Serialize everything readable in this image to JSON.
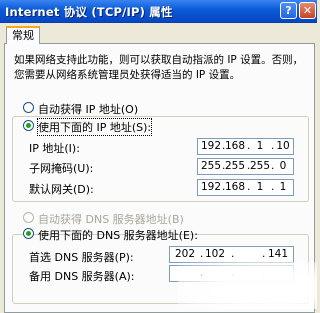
{
  "window": {
    "title": "Internet 协议 (TCP/IP) 属性",
    "help_glyph": "?",
    "close_glyph": "✕"
  },
  "tabs": [
    {
      "label": "常规",
      "active": true
    }
  ],
  "description": "如果网络支持此功能，则可以获取自动指派的 IP 设置。否则，您需要从网络系统管理员处获得适当的 IP 设置。",
  "ip_section": {
    "auto_option": "自动获得 IP 地址(O)",
    "manual_option": "使用下面的 IP 地址(S):",
    "selected": "manual",
    "fields": [
      {
        "label": "IP 地址(I):",
        "octets": [
          "192",
          "168",
          "1",
          "10"
        ]
      },
      {
        "label": "子网掩码(U):",
        "octets": [
          "255",
          "255",
          "255",
          "0"
        ]
      },
      {
        "label": "默认网关(D):",
        "octets": [
          "192",
          "168",
          "1",
          "1"
        ]
      }
    ]
  },
  "dns_section": {
    "auto_option": "自动获得 DNS 服务器地址(B)",
    "manual_option": "使用下面的 DNS 服务器地址(E):",
    "selected": "manual",
    "fields": [
      {
        "label": "首选 DNS 服务器(P):",
        "octets": [
          "202",
          "102",
          "",
          "141"
        ]
      },
      {
        "label": "备用 DNS 服务器(A):",
        "octets": [
          "",
          "",
          "",
          ""
        ]
      }
    ]
  },
  "colors": {
    "titlebar": "#0a5ad7",
    "dialog_bg": "#ece9d8",
    "tab_accent": "#f5a623",
    "radio_dot": "#21a121"
  }
}
